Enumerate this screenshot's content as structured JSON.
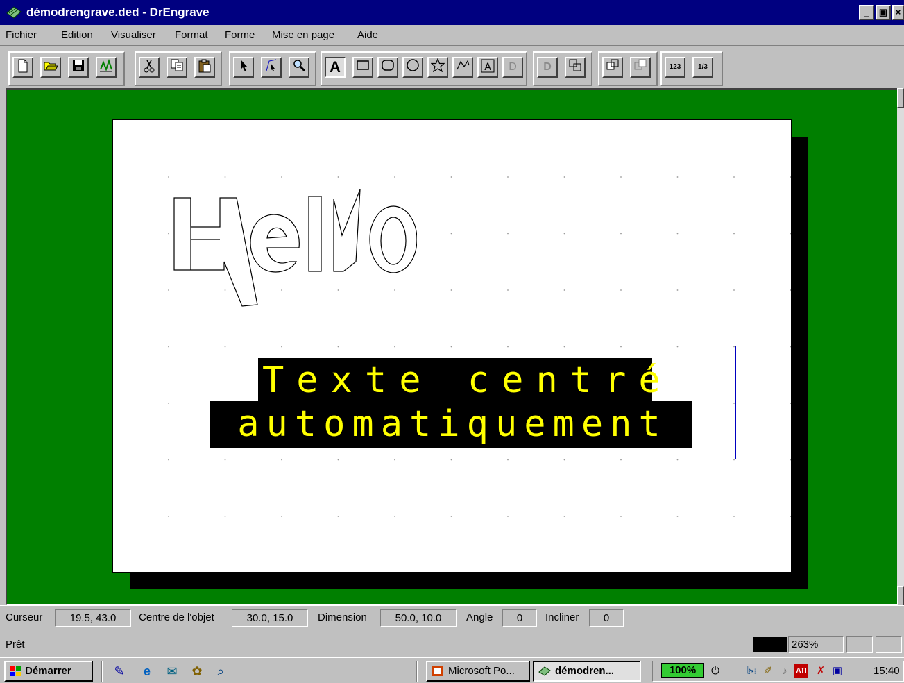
{
  "window": {
    "title": "démodrengrave.ded - DrEngrave",
    "min": "_",
    "max": "▣",
    "close": "×"
  },
  "menu": [
    {
      "label": "Fichier"
    },
    {
      "label": "Edition"
    },
    {
      "label": "Visualiser"
    },
    {
      "label": "Format"
    },
    {
      "label": "Forme"
    },
    {
      "label": "Mise en page"
    },
    {
      "label": "Aide"
    }
  ],
  "toolbar": {
    "new_icon": "new-document-icon",
    "open_icon": "open-folder-icon",
    "save_icon": "save-disk-icon",
    "import_icon": "import-image-icon",
    "cut_icon": "scissors-icon",
    "copy_icon": "copy-icon",
    "paste_icon": "paste-icon",
    "select_icon": "arrow-pointer-icon",
    "node_icon": "node-edit-icon",
    "zoom_icon": "magnifier-icon",
    "text_tool_label": "A",
    "frame_text_label": "A",
    "disabled_d1": "D",
    "disabled_d2": "D",
    "numbering_label": "123",
    "vertical_numbering_label": "1/3"
  },
  "canvas": {
    "hello_text": "Hello",
    "line1": "Texte centré",
    "line2": "automatiquement"
  },
  "fields": {
    "cursor_label": "Curseur",
    "cursor_value": "19.5, 43.0",
    "center_label": "Centre de l'objet",
    "center_value": "30.0, 15.0",
    "dimension_label": "Dimension",
    "dimension_value": "50.0, 10.0",
    "angle_label": "Angle",
    "angle_value": "0",
    "skew_label": "Incliner",
    "skew_value": "0"
  },
  "status": {
    "text": "Prêt",
    "zoom": "263%"
  },
  "taskbar": {
    "start": "Démarrer",
    "task1": "Microsoft Po...",
    "task2": "démodren...",
    "battery": "100%",
    "clock": "15:40"
  },
  "colors": {
    "workspace": "#007f00",
    "titlebar": "#000080",
    "engrave_text": "#ffff00",
    "frame": "#0000c0"
  }
}
